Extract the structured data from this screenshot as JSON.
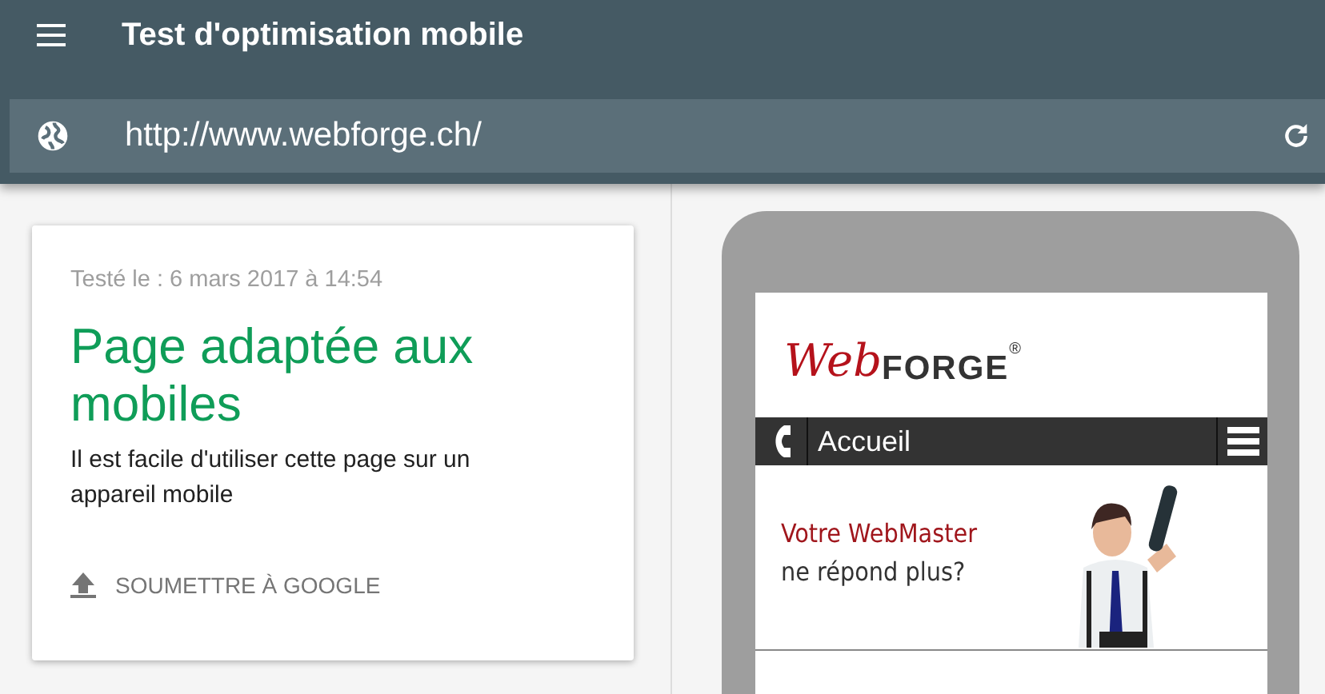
{
  "app_bar": {
    "title": "Test d'optimisation mobile"
  },
  "url_bar": {
    "value": "http://www.webforge.ch/"
  },
  "result_card": {
    "tested": "Testé le : 6 mars 2017 à 14:54",
    "verdict": "Page adaptée aux mobiles",
    "description": "Il est facile d'utiliser cette page sur un appareil mobile",
    "action": "SOUMETTRE À GOOGLE"
  },
  "phone_preview": {
    "logo_script": "Web",
    "logo_word": "FORGE",
    "logo_mark": "®",
    "nav_label": "Accueil",
    "hero_line_1": "Votre WebMaster",
    "hero_line_2": "ne répond plus?"
  }
}
